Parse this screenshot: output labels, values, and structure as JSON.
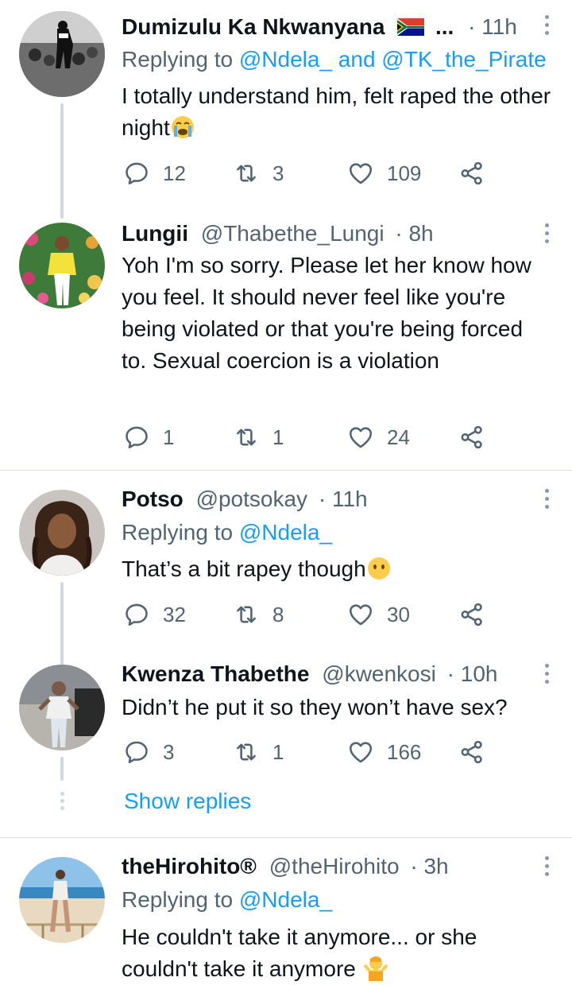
{
  "tweets": [
    {
      "name": "Dumizulu Ka Nkwanyana",
      "name_suffix": "...",
      "handle": "",
      "dot": "·",
      "time": "11h",
      "reply_prefix": "Replying to",
      "reply_targets": "@Ndela_ and @TK_the_Pirate",
      "text": "I totally understand him, felt raped the other night",
      "replies": "12",
      "retweets": "3",
      "likes": "109"
    },
    {
      "name": "Lungii",
      "handle": "@Thabethe_Lungi",
      "dot": "·",
      "time": "8h",
      "text": "Yoh I'm so sorry. Please let her know how you feel. It should never feel like you're being violated or that you're being forced to. Sexual coercion is a violation",
      "replies": "1",
      "retweets": "1",
      "likes": "24"
    },
    {
      "name": "Potso",
      "handle": "@potsokay",
      "dot": "·",
      "time": "11h",
      "reply_prefix": "Replying to",
      "reply_targets": "@Ndela_",
      "text": "That’s a bit rapey though",
      "replies": "32",
      "retweets": "8",
      "likes": "30"
    },
    {
      "name": "Kwenza Thabethe",
      "handle": "@kwenkosi",
      "dot": "·",
      "time": "10h",
      "text": "Didn’t he put it so they won’t have sex?",
      "replies": "3",
      "retweets": "1",
      "likes": "166"
    },
    {
      "name": "theHirohito®",
      "handle": "@theHirohito",
      "dot": "·",
      "time": "3h",
      "reply_prefix": "Replying to",
      "reply_targets": "@Ndela_",
      "text": "He couldn't take it anymore... or she couldn't take it anymore"
    }
  ],
  "show_replies": "Show replies",
  "colors": {
    "link": "#1d9bf0",
    "secondary": "#536471",
    "text": "#0f1419",
    "thread": "#cfd9de"
  },
  "icons": [
    "reply-icon",
    "retweet-icon",
    "like-icon",
    "share-icon",
    "more-icon"
  ]
}
